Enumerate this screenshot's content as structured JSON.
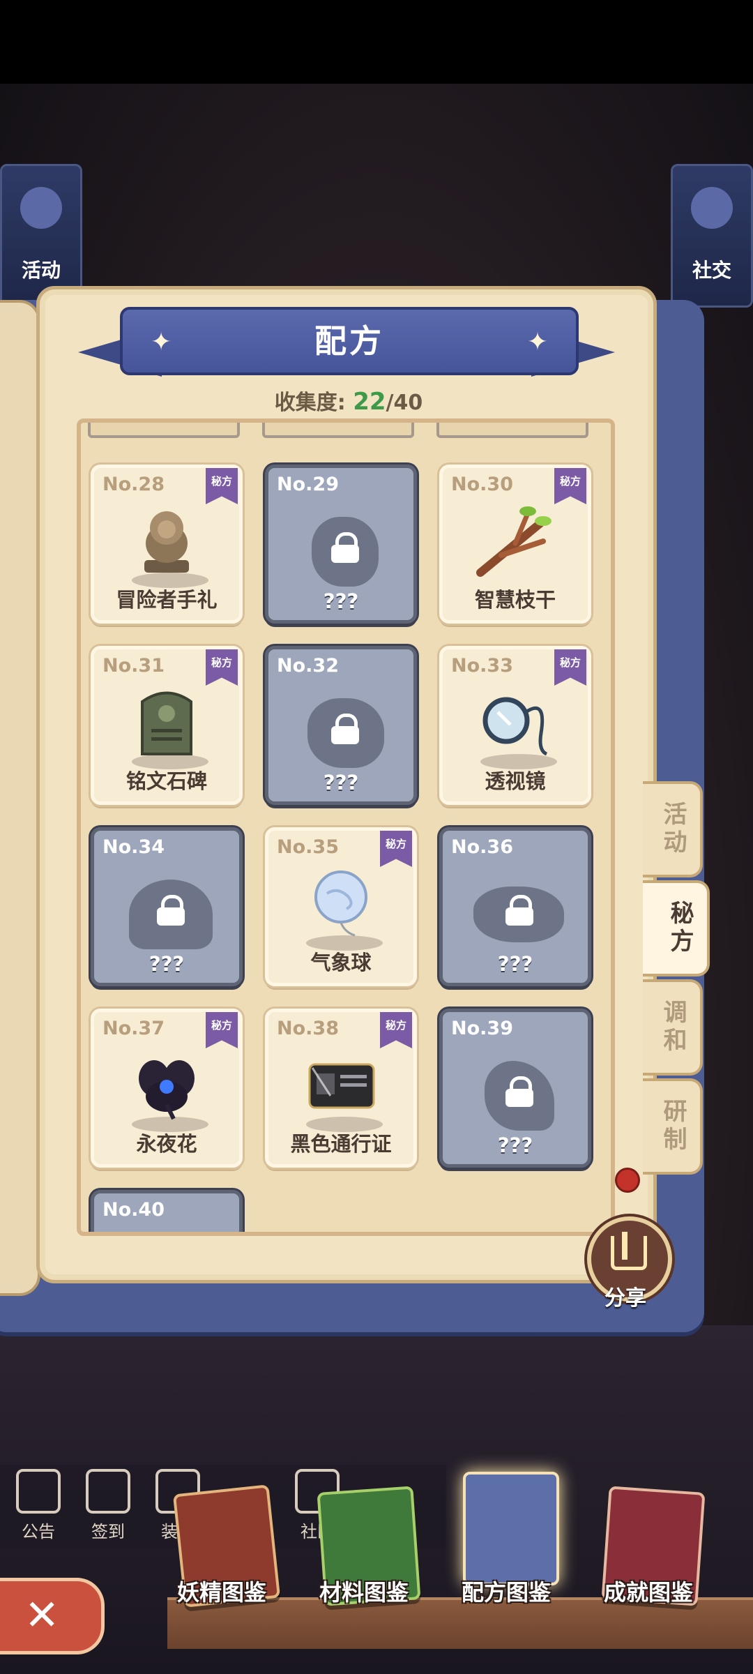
{
  "header": {
    "title": "配方",
    "collect_label": "收集度:",
    "collect_current": "22",
    "collect_total": "/40"
  },
  "cards": [
    {
      "no": "No.28",
      "name": "冒险者手礼",
      "locked": false,
      "badge": "秘方",
      "icon": "lion-statue-icon"
    },
    {
      "no": "No.29",
      "name": "???",
      "locked": true,
      "badge": "",
      "icon": "lock-icon"
    },
    {
      "no": "No.30",
      "name": "智慧枝干",
      "locked": false,
      "badge": "秘方",
      "icon": "branch-icon"
    },
    {
      "no": "No.31",
      "name": "铭文石碑",
      "locked": false,
      "badge": "秘方",
      "icon": "stone-tablet-icon"
    },
    {
      "no": "No.32",
      "name": "???",
      "locked": true,
      "badge": "",
      "icon": "lock-icon"
    },
    {
      "no": "No.33",
      "name": "透视镜",
      "locked": false,
      "badge": "秘方",
      "icon": "monocle-icon"
    },
    {
      "no": "No.34",
      "name": "???",
      "locked": true,
      "badge": "",
      "icon": "lock-icon"
    },
    {
      "no": "No.35",
      "name": "气象球",
      "locked": false,
      "badge": "秘方",
      "icon": "weather-balloon-icon"
    },
    {
      "no": "No.36",
      "name": "???",
      "locked": true,
      "badge": "",
      "icon": "lock-icon"
    },
    {
      "no": "No.37",
      "name": "永夜花",
      "locked": false,
      "badge": "秘方",
      "icon": "night-flower-icon"
    },
    {
      "no": "No.38",
      "name": "黑色通行证",
      "locked": false,
      "badge": "秘方",
      "icon": "black-pass-icon"
    },
    {
      "no": "No.39",
      "name": "???",
      "locked": true,
      "badge": "",
      "icon": "lock-icon"
    },
    {
      "no": "No.40",
      "name": "",
      "locked": true,
      "badge": "",
      "icon": ""
    }
  ],
  "side_tabs": [
    {
      "label": "活动",
      "active": false
    },
    {
      "label": "秘方",
      "active": true
    },
    {
      "label": "调和",
      "active": false
    },
    {
      "label": "研制",
      "active": false
    }
  ],
  "side_banners": {
    "left": "活动",
    "right": "社交"
  },
  "share_label": "分享",
  "shelf_icons": [
    "公告",
    "签到",
    "装饰",
    "社区"
  ],
  "bottom_tabs": [
    {
      "label": "妖精图鉴",
      "color": "#8e3b2e"
    },
    {
      "label": "材料图鉴",
      "color": "#3f7a3a"
    },
    {
      "label": "配方图鉴",
      "color": "#5d6fa8"
    },
    {
      "label": "成就图鉴",
      "color": "#8a2f3a"
    }
  ]
}
